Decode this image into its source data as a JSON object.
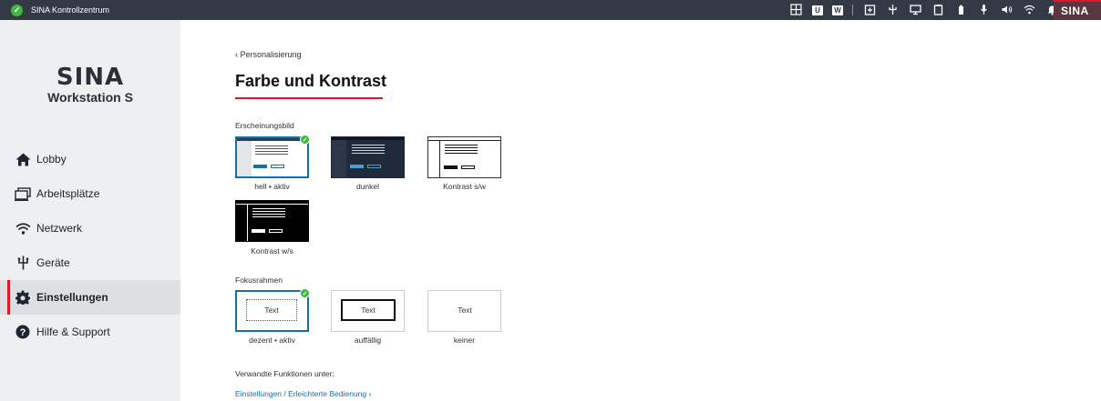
{
  "window": {
    "title": "SINA Kontrollzentrum",
    "brand": "SINA"
  },
  "tray": {
    "icons": [
      "grid-icon",
      "u-badge-icon",
      "w-badge-icon",
      "separator",
      "plus-window-icon",
      "usb-icon",
      "monitor-icon",
      "clipboard-icon",
      "battery-icon",
      "microphone-icon",
      "speaker-icon",
      "wifi-icon",
      "bell-icon"
    ],
    "u_label": "U",
    "w_label": "W"
  },
  "sidebar": {
    "logo": {
      "mark": "SINA",
      "subtitle": "Workstation S"
    },
    "items": [
      {
        "label": "Lobby",
        "icon": "home-icon"
      },
      {
        "label": "Arbeitsplätze",
        "icon": "workspace-icon"
      },
      {
        "label": "Netzwerk",
        "icon": "wifi-icon"
      },
      {
        "label": "Geräte",
        "icon": "usb-icon"
      },
      {
        "label": "Einstellungen",
        "icon": "gear-icon",
        "active": true
      },
      {
        "label": "Hilfe & Support",
        "icon": "help-icon"
      }
    ]
  },
  "main": {
    "breadcrumb": "‹ Personalisierung",
    "title": "Farbe und Kontrast",
    "appearance": {
      "heading": "Erscheinungsbild",
      "options": [
        {
          "label": "hell • aktiv",
          "selected": true
        },
        {
          "label": "dunkel",
          "selected": false
        },
        {
          "label": "Kontrast s/w",
          "selected": false
        },
        {
          "label": "Kontrast w/s",
          "selected": false
        }
      ]
    },
    "focus": {
      "heading": "Fokusrahmen",
      "preview_text": "Text",
      "options": [
        {
          "label": "dezent • aktiv",
          "selected": true
        },
        {
          "label": "auffällig",
          "selected": false
        },
        {
          "label": "keiner",
          "selected": false
        }
      ]
    },
    "related": {
      "heading": "Verwandte Funktionen unter:",
      "link": "Einstellungen / Erleichterte Bedienung  ›"
    }
  },
  "colors": {
    "accent": "#d81b2b",
    "topbar": "#343a45",
    "selection": "#1b6fa0",
    "check": "#3eb83e"
  }
}
